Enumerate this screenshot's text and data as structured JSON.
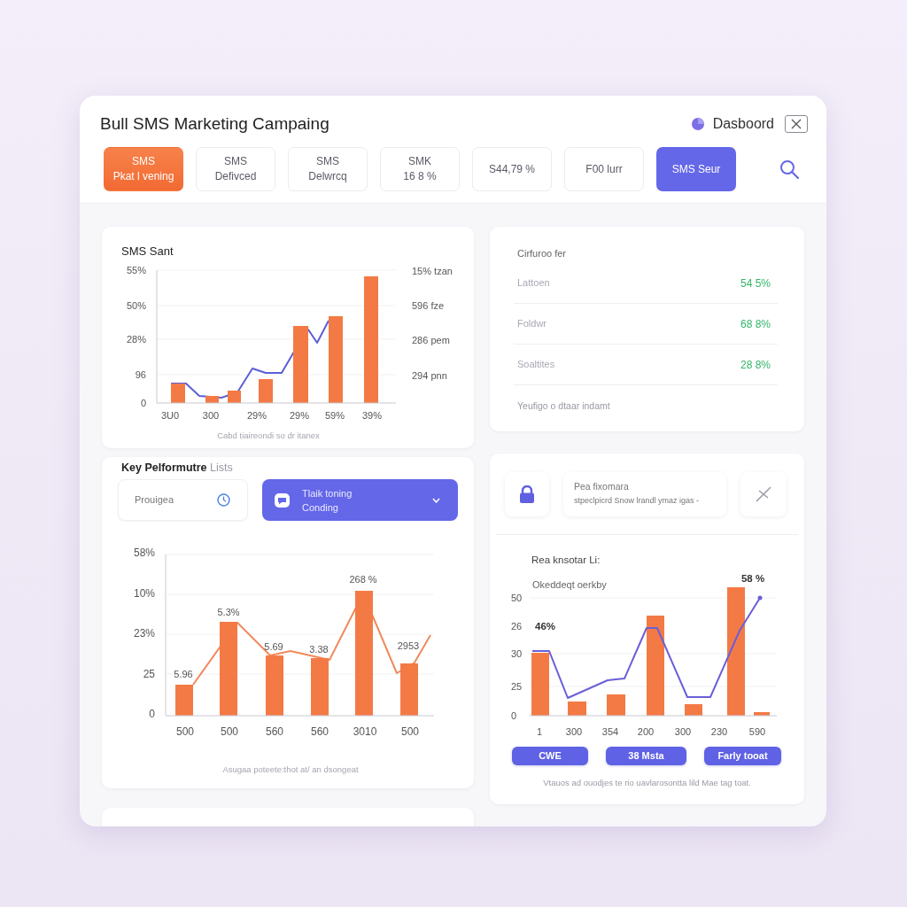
{
  "header": {
    "title": "Bull SMS Marketing Campaing",
    "nav_label": "Dasboord"
  },
  "filters": [
    {
      "lines": [
        "SMS",
        "Pkat l vening"
      ],
      "kind": "accent"
    },
    {
      "lines": [
        "SMS",
        "Defivced"
      ],
      "kind": "plain"
    },
    {
      "lines": [
        "SMS",
        "Delwrcq"
      ],
      "kind": "plain"
    },
    {
      "lines": [
        "SMK",
        "16 8 %"
      ],
      "kind": "plain"
    },
    {
      "lines": [
        "S44,79 %"
      ],
      "kind": "plain"
    },
    {
      "lines": [
        "F00 lurr"
      ],
      "kind": "plain"
    },
    {
      "lines": [
        "SMS Seur"
      ],
      "kind": "primary"
    }
  ],
  "sms_sent": {
    "title": "SMS Sant",
    "y_labels": [
      "55%",
      "50%",
      "28%",
      "96",
      "0"
    ],
    "side_labels": [
      "15% tzan",
      "596 fze",
      "286 pem",
      "294 pnn"
    ],
    "x_labels": [
      "3U0",
      "300",
      "29%",
      "29%",
      "59%",
      "39%"
    ],
    "caption": "Cabd tiaireondi so dr itanex"
  },
  "conversion": {
    "title": "Cirfuroo fer",
    "rows": [
      {
        "label": "Lattoen",
        "value": "54 5%"
      },
      {
        "label": "Foldwr",
        "value": "68 8%"
      },
      {
        "label": "Soaltites",
        "value": "28 8%"
      }
    ],
    "footer": "Yeufigo o dtaar indamt"
  },
  "key_performance": {
    "title": "**Key Pelformutre** Lists",
    "select": {
      "label": "Prouigea"
    },
    "dropdown": {
      "lines": [
        "Tlaik toning",
        "Conding"
      ]
    },
    "y_labels": [
      "58%",
      "10%",
      "23%",
      "25",
      "0"
    ],
    "data_labels": [
      "5.96",
      "5.3%",
      "5.69",
      "3.38",
      "268 %",
      "2953"
    ],
    "x_labels": [
      "500",
      "500",
      "560",
      "560",
      "3010",
      "500"
    ],
    "caption": "Asugaa poteete:thot at/ an dsongeat"
  },
  "insights": {
    "notice": {
      "title": "Pea fixomara",
      "text": "stpeclpicrd Snow lrandl ymaz igas -"
    },
    "title": "Rea knsotar Li:",
    "subtitle": "Okeddeqt oerkby",
    "y_labels": [
      "50",
      "26",
      "30",
      "25",
      "0"
    ],
    "callouts": [
      "46%",
      "58 %"
    ],
    "x_labels": [
      "1",
      "300",
      "354",
      "200",
      "300",
      "230",
      "590"
    ],
    "buttons": [
      "CWE",
      "38 Msta",
      "Farly tooat"
    ],
    "caption": "Vtauos ad ouodjes te rio uavlarosontta lild Mae tag toat."
  }
}
